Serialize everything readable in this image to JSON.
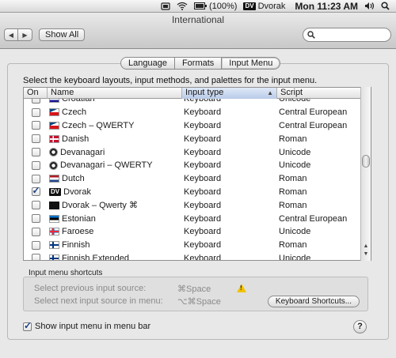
{
  "menubar": {
    "battery": "(100%)",
    "input_badge": "DV",
    "input_name": "Dvorak",
    "clock": "Mon 11:23 AM"
  },
  "window": {
    "title": "International",
    "show_all": "Show All",
    "search_placeholder": ""
  },
  "tabs": [
    {
      "label": "Language"
    },
    {
      "label": "Formats"
    },
    {
      "label": "Input Menu",
      "active": true
    }
  ],
  "instructions": "Select the keyboard layouts, input methods, and palettes for the input menu.",
  "table": {
    "columns": [
      "On",
      "Name",
      "Input type",
      "Script"
    ],
    "rows": [
      {
        "on": false,
        "name": "Croatian",
        "type": "Keyboard",
        "script": "Unicode",
        "flag": "hr"
      },
      {
        "on": false,
        "name": "Czech",
        "type": "Keyboard",
        "script": "Central European",
        "flag": "cz"
      },
      {
        "on": false,
        "name": "Czech – QWERTY",
        "type": "Keyboard",
        "script": "Central European",
        "flag": "cz"
      },
      {
        "on": false,
        "name": "Danish",
        "type": "Keyboard",
        "script": "Roman",
        "flag": "dk"
      },
      {
        "on": false,
        "name": "Devanagari",
        "type": "Keyboard",
        "script": "Unicode",
        "flag": "deva"
      },
      {
        "on": false,
        "name": "Devanagari – QWERTY",
        "type": "Keyboard",
        "script": "Unicode",
        "flag": "deva"
      },
      {
        "on": false,
        "name": "Dutch",
        "type": "Keyboard",
        "script": "Roman",
        "flag": "nl"
      },
      {
        "on": true,
        "name": "Dvorak",
        "type": "Keyboard",
        "script": "Roman",
        "flag": "dv"
      },
      {
        "on": false,
        "name": "Dvorak – Qwerty ⌘",
        "type": "Keyboard",
        "script": "Roman",
        "flag": "dq"
      },
      {
        "on": false,
        "name": "Estonian",
        "type": "Keyboard",
        "script": "Central European",
        "flag": "ee"
      },
      {
        "on": false,
        "name": "Faroese",
        "type": "Keyboard",
        "script": "Unicode",
        "flag": "fo"
      },
      {
        "on": false,
        "name": "Finnish",
        "type": "Keyboard",
        "script": "Roman",
        "flag": "fi"
      },
      {
        "on": false,
        "name": "Finnish Extended",
        "type": "Keyboard",
        "script": "Unicode",
        "flag": "fi"
      }
    ]
  },
  "shortcuts": {
    "title": "Input menu shortcuts",
    "prev_label": "Select previous input source:",
    "prev_key": "⌘Space",
    "next_label": "Select next input source in menu:",
    "next_key": "⌥⌘Space",
    "button": "Keyboard Shortcuts..."
  },
  "show_menu_label": "Show input menu in menu bar",
  "show_menu_checked": true,
  "help": "?"
}
